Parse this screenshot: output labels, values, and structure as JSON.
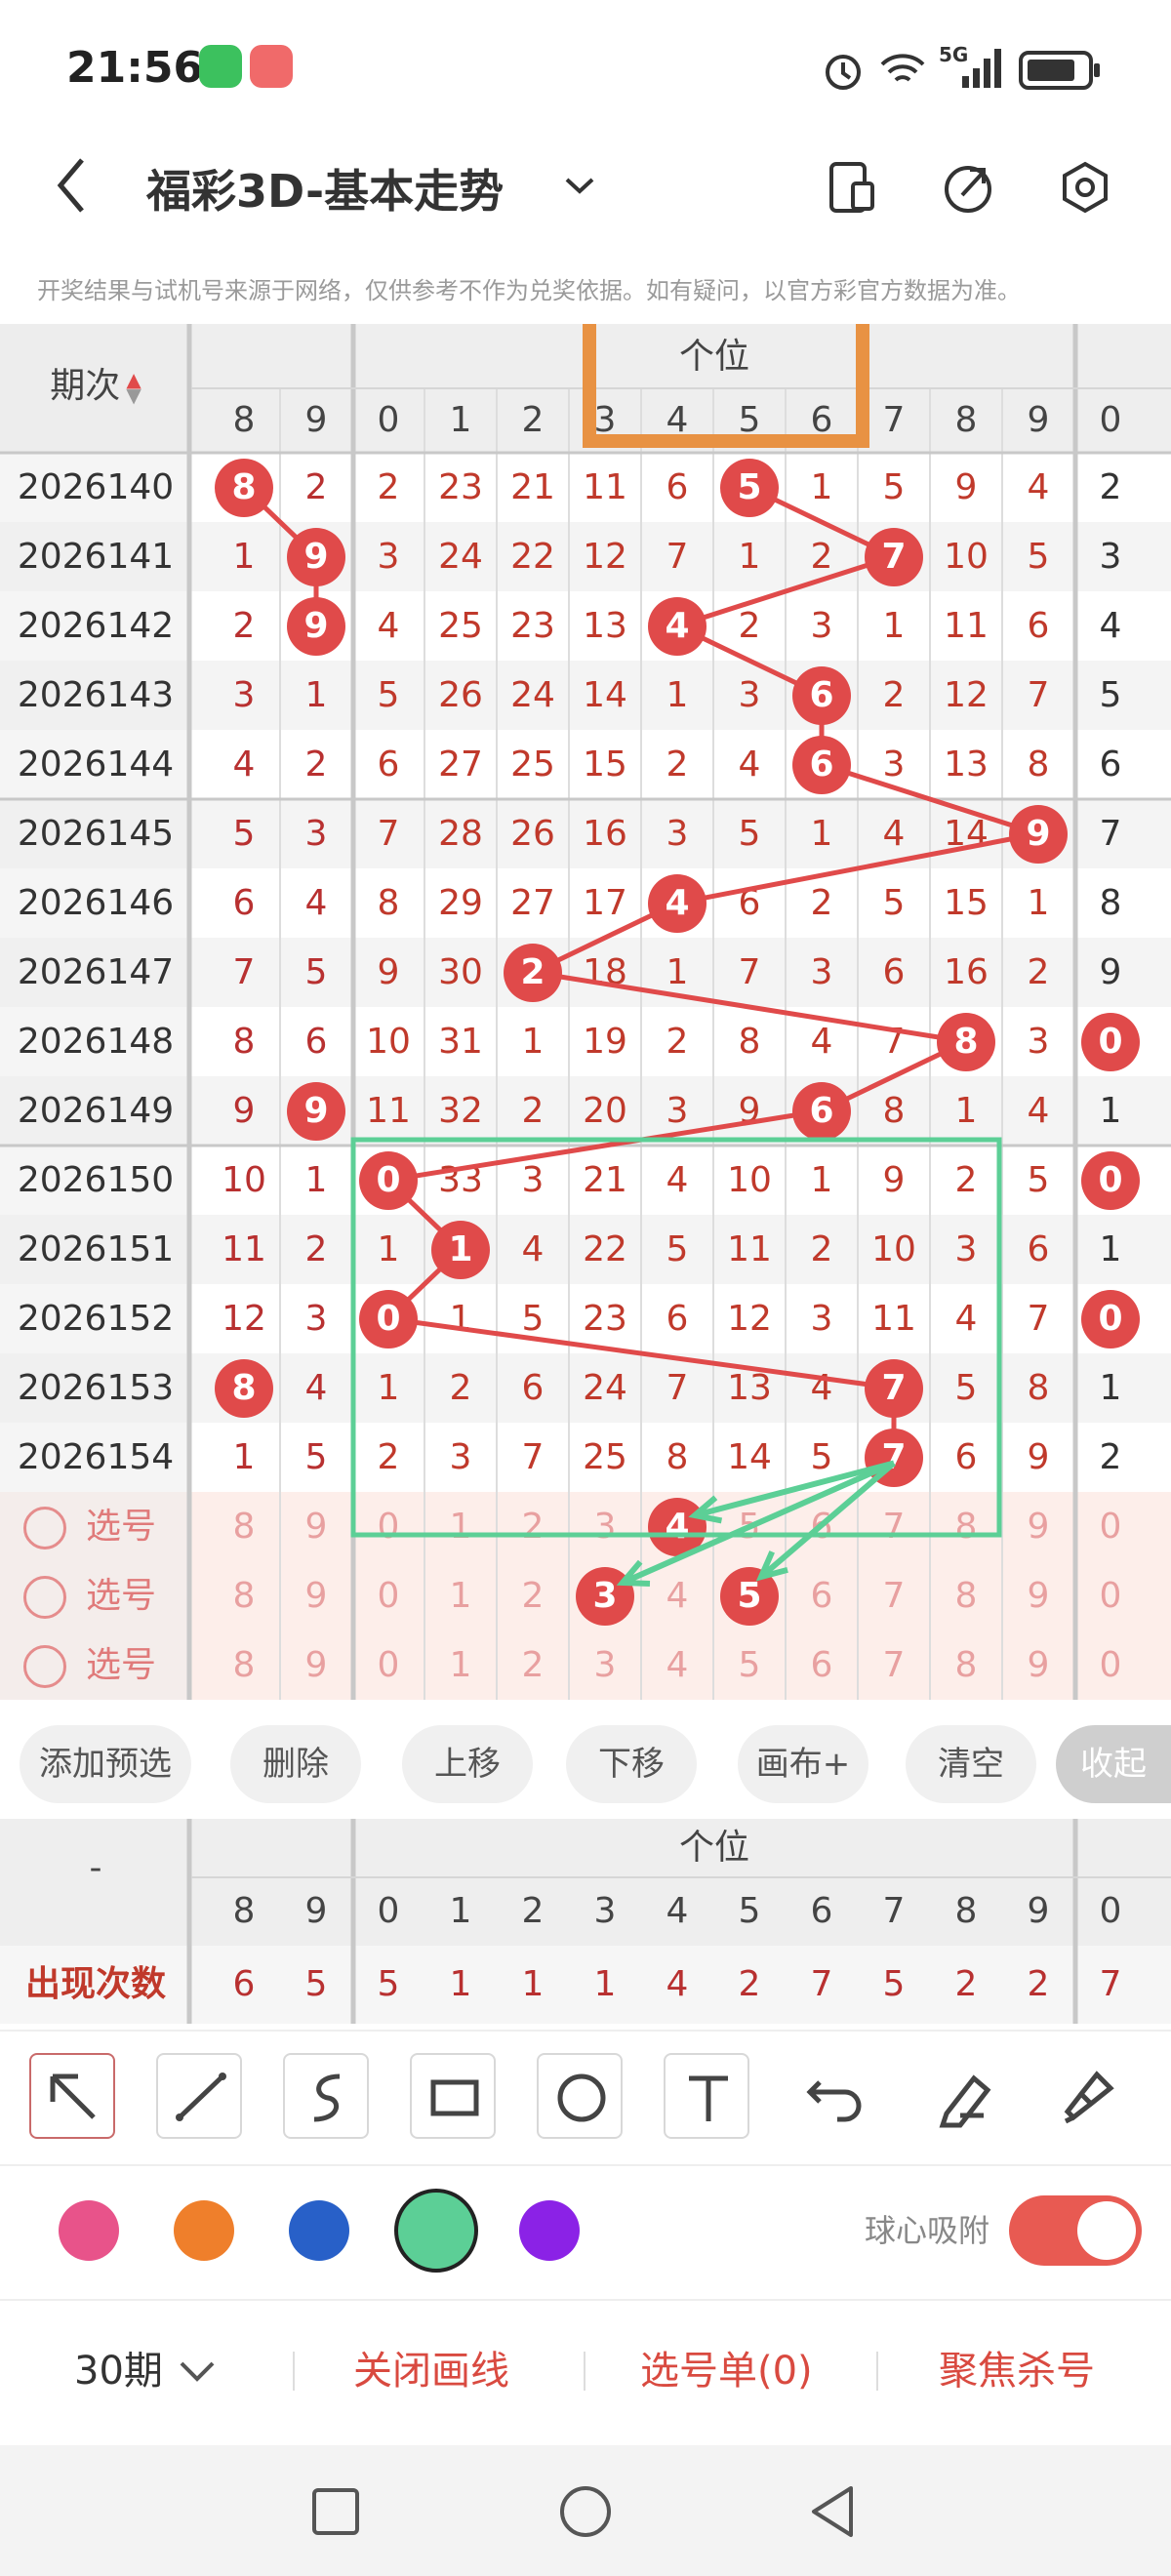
{
  "status_bar": {
    "time": "21:56",
    "network_label": "5G",
    "icons": [
      "wechat-icon",
      "app-icon",
      "alarm-icon",
      "wifi-icon",
      "signal-icon",
      "battery-icon"
    ]
  },
  "header": {
    "title": "福彩3D-基本走势",
    "icons": [
      "back-icon",
      "chevron-down-icon",
      "phone-layout-icon",
      "share-icon",
      "settings-icon"
    ]
  },
  "disclaimer": "开奖结果与试机号来源于网络，仅供参考不作为兑奖依据。如有疑问，以官方彩官方数据为准。",
  "table": {
    "period_header": "期次",
    "section_label": "个位",
    "col_headers_left": [
      "8",
      "9"
    ],
    "col_headers_main": [
      "0",
      "1",
      "2",
      "3",
      "4",
      "5",
      "6",
      "7",
      "8",
      "9"
    ],
    "col_header_right": "0",
    "rows": [
      {
        "period": "2026140",
        "left": [
          "8",
          "2"
        ],
        "main": [
          "2",
          "23",
          "21",
          "11",
          "6",
          "5",
          "1",
          "5",
          "9",
          "4"
        ],
        "right": "2",
        "ball_left": 0,
        "ball_main": 5
      },
      {
        "period": "2026141",
        "left": [
          "1",
          "9"
        ],
        "main": [
          "3",
          "24",
          "22",
          "12",
          "7",
          "1",
          "2",
          "7",
          "10",
          "5"
        ],
        "right": "3",
        "ball_left": 1,
        "ball_main": 7
      },
      {
        "period": "2026142",
        "left": [
          "2",
          "9"
        ],
        "main": [
          "4",
          "25",
          "23",
          "13",
          "4",
          "2",
          "3",
          "1",
          "11",
          "6"
        ],
        "right": "4",
        "ball_left": 1,
        "ball_main": 4
      },
      {
        "period": "2026143",
        "left": [
          "3",
          "1"
        ],
        "main": [
          "5",
          "26",
          "24",
          "14",
          "1",
          "3",
          "6",
          "2",
          "12",
          "7"
        ],
        "right": "5",
        "ball_left": -1,
        "ball_main": 6
      },
      {
        "period": "2026144",
        "left": [
          "4",
          "2"
        ],
        "main": [
          "6",
          "27",
          "25",
          "15",
          "2",
          "4",
          "6",
          "3",
          "13",
          "8"
        ],
        "right": "6",
        "ball_left": -1,
        "ball_main": 6
      },
      {
        "period": "2026145",
        "left": [
          "5",
          "3"
        ],
        "main": [
          "7",
          "28",
          "26",
          "16",
          "3",
          "5",
          "1",
          "4",
          "14",
          "9"
        ],
        "right": "7",
        "ball_left": -1,
        "ball_main": 9
      },
      {
        "period": "2026146",
        "left": [
          "6",
          "4"
        ],
        "main": [
          "8",
          "29",
          "27",
          "17",
          "4",
          "6",
          "2",
          "5",
          "15",
          "1"
        ],
        "right": "8",
        "ball_left": -1,
        "ball_main": 4
      },
      {
        "period": "2026147",
        "left": [
          "7",
          "5"
        ],
        "main": [
          "9",
          "30",
          "2",
          "18",
          "1",
          "7",
          "3",
          "6",
          "16",
          "2"
        ],
        "right": "9",
        "ball_left": -1,
        "ball_main": 2
      },
      {
        "period": "2026148",
        "left": [
          "8",
          "6"
        ],
        "main": [
          "10",
          "31",
          "1",
          "19",
          "2",
          "8",
          "4",
          "7",
          "8",
          "3"
        ],
        "right": "0",
        "ball_left": -1,
        "ball_main": 8,
        "ball_right": true
      },
      {
        "period": "2026149",
        "left": [
          "9",
          "9"
        ],
        "main": [
          "11",
          "32",
          "2",
          "20",
          "3",
          "9",
          "6",
          "8",
          "1",
          "4"
        ],
        "right": "1",
        "ball_left": 1,
        "ball_main": 6
      },
      {
        "period": "2026150",
        "left": [
          "10",
          "1"
        ],
        "main": [
          "0",
          "33",
          "3",
          "21",
          "4",
          "10",
          "1",
          "9",
          "2",
          "5"
        ],
        "right": "0",
        "ball_left": -1,
        "ball_main": 0,
        "ball_right": true
      },
      {
        "period": "2026151",
        "left": [
          "11",
          "2"
        ],
        "main": [
          "1",
          "1",
          "4",
          "22",
          "5",
          "11",
          "2",
          "10",
          "3",
          "6"
        ],
        "right": "1",
        "ball_left": -1,
        "ball_main": 1
      },
      {
        "period": "2026152",
        "left": [
          "12",
          "3"
        ],
        "main": [
          "0",
          "1",
          "5",
          "23",
          "6",
          "12",
          "3",
          "11",
          "4",
          "7"
        ],
        "right": "0",
        "ball_left": -1,
        "ball_main": 0,
        "ball_right": true
      },
      {
        "period": "2026153",
        "left": [
          "8",
          "4"
        ],
        "main": [
          "1",
          "2",
          "6",
          "24",
          "7",
          "13",
          "4",
          "7",
          "5",
          "8"
        ],
        "right": "1",
        "ball_left": 0,
        "ball_main": 7
      },
      {
        "period": "2026154",
        "left": [
          "1",
          "5"
        ],
        "main": [
          "2",
          "3",
          "7",
          "25",
          "8",
          "14",
          "5",
          "7",
          "6",
          "9"
        ],
        "right": "2",
        "ball_left": -1,
        "ball_main": 7
      }
    ],
    "pick_label": "选号",
    "pick_rows": [
      {
        "left": [
          "8",
          "9"
        ],
        "main": [
          "0",
          "1",
          "2",
          "3",
          "4",
          "5",
          "6",
          "7",
          "8",
          "9"
        ],
        "right": "0",
        "ball": 4
      },
      {
        "left": [
          "8",
          "9"
        ],
        "main": [
          "0",
          "1",
          "2",
          "3",
          "4",
          "5",
          "6",
          "7",
          "8",
          "9"
        ],
        "right": "0",
        "balls": [
          3,
          5
        ]
      },
      {
        "left": [
          "8",
          "9"
        ],
        "main": [
          "0",
          "1",
          "2",
          "3",
          "4",
          "5",
          "6",
          "7",
          "8",
          "9"
        ],
        "right": "0"
      }
    ]
  },
  "buttons": [
    "添加预选",
    "删除",
    "上移",
    "下移",
    "画布+",
    "清空",
    "收起"
  ],
  "stats": {
    "dash": "-",
    "section_label": "个位",
    "header_left": [
      "8",
      "9"
    ],
    "header_main": [
      "0",
      "1",
      "2",
      "3",
      "4",
      "5",
      "6",
      "7",
      "8",
      "9"
    ],
    "header_right": "0",
    "row_label": "出现次数",
    "values_left": [
      "6",
      "5"
    ],
    "values_main": [
      "5",
      "1",
      "1",
      "1",
      "4",
      "2",
      "7",
      "5",
      "2",
      "2"
    ],
    "value_right": "7"
  },
  "tools": [
    "arrow-tool-icon",
    "line-tool-icon",
    "curve-tool-icon",
    "rectangle-tool-icon",
    "circle-tool-icon",
    "text-tool-icon",
    "undo-icon",
    "eraser-icon",
    "brush-icon"
  ],
  "colors": {
    "swatches": [
      "#e8538a",
      "#ef7f2b",
      "#2860c8",
      "#5ccf96",
      "#8b22e6"
    ],
    "accent": "#e04a4a",
    "selected_swatch": "#5ccf96",
    "highlight_orange": "#e89243",
    "highlight_green": "#5ccf96"
  },
  "snap_label": "球心吸附",
  "snap_on": true,
  "bottom": {
    "period_select": "30期",
    "close_line": "关闭画线",
    "pick_list": "选号单(0)",
    "focus_kill": "聚焦杀号"
  },
  "nav": [
    "square-nav-icon",
    "circle-nav-icon",
    "back-nav-icon"
  ]
}
